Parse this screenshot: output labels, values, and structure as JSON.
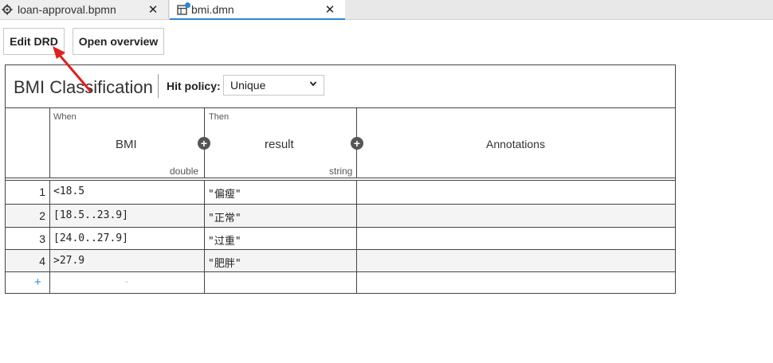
{
  "tabs": [
    {
      "label": "loan-approval.bpmn",
      "icon": "gear-icon",
      "close": "✕"
    },
    {
      "label": "bmi.dmn",
      "icon": "dmn-table-icon",
      "close": "✕",
      "unsaved": true
    }
  ],
  "toolbar": {
    "edit_drd": "Edit DRD",
    "open_overview": "Open overview"
  },
  "decision": {
    "name": "BMI Classification",
    "hit_policy_label": "Hit policy:",
    "hit_policy_value": "Unique"
  },
  "columns": {
    "input": {
      "group": "When",
      "label": "BMI",
      "type": "double"
    },
    "output": {
      "group": "Then",
      "label": "result",
      "type": "string"
    },
    "annotations": "Annotations"
  },
  "rules": [
    {
      "num": "1",
      "input": "<18.5",
      "output": "\"偏瘦\""
    },
    {
      "num": "2",
      "input": "[18.5..23.9]",
      "output": "\"正常\""
    },
    {
      "num": "3",
      "input": "[24.0..27.9]",
      "output": "\"过重\""
    },
    {
      "num": "4",
      "input": ">27.9",
      "output": "\"肥胖\""
    }
  ],
  "add_row": {
    "plus": "+",
    "placeholder": "-"
  },
  "colors": {
    "accent": "#2a86d4",
    "arrow": "#e02020"
  }
}
